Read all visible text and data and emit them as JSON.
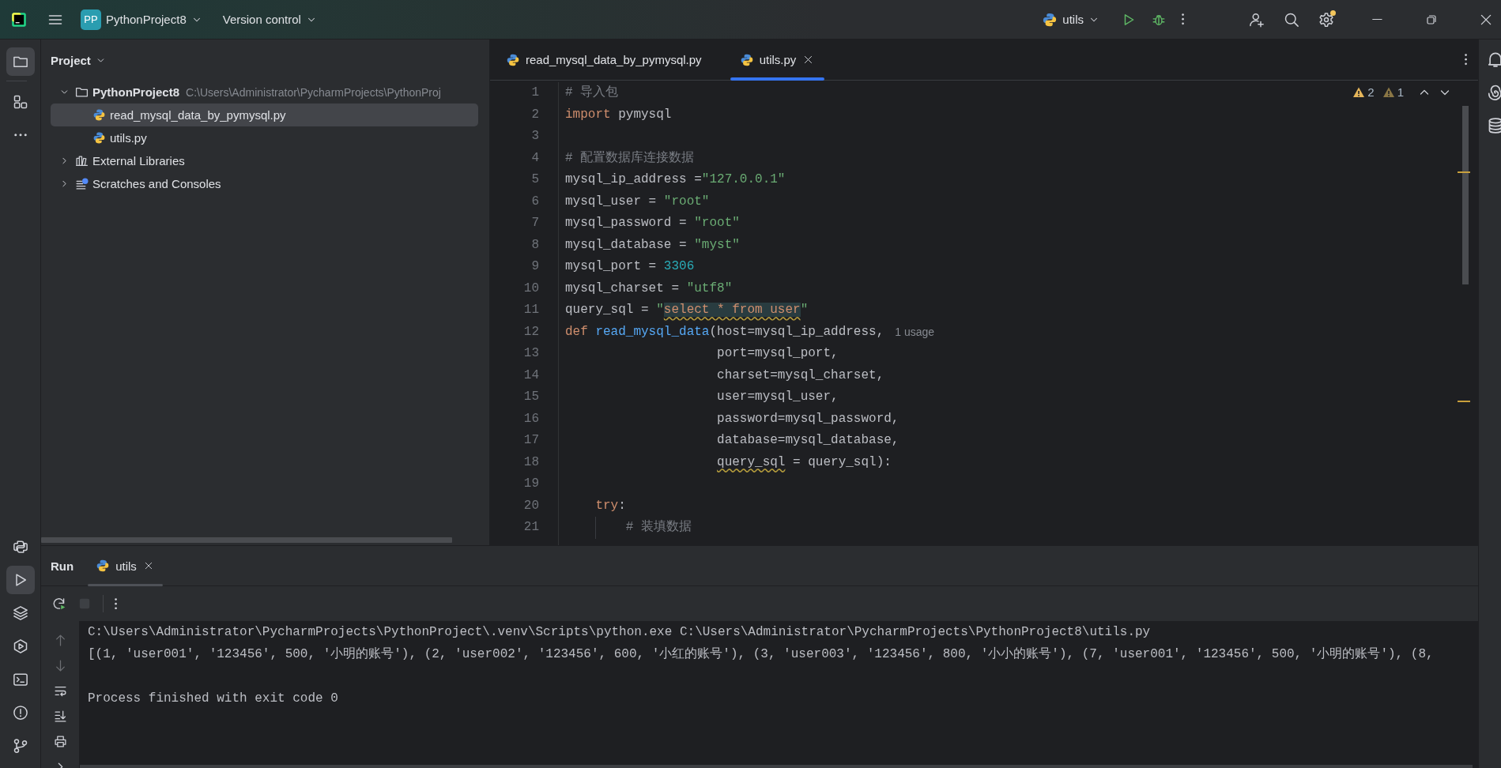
{
  "title_bar": {
    "project_badge": "PP",
    "project": "PythonProject8",
    "vcs": "Version control",
    "run_config": "utils",
    "settings_notification": true
  },
  "left_toolbar": {
    "top": [
      {
        "kind": "project",
        "selected": true
      },
      {
        "kind": "structure",
        "selected": false
      },
      {
        "kind": "more",
        "selected": false
      }
    ],
    "bottom": [
      {
        "kind": "python-console",
        "selected": false
      },
      {
        "kind": "run",
        "selected": true
      },
      {
        "kind": "layers",
        "selected": false
      },
      {
        "kind": "services",
        "selected": false
      },
      {
        "kind": "terminal",
        "selected": false
      },
      {
        "kind": "problems",
        "selected": false
      },
      {
        "kind": "git",
        "selected": false
      }
    ]
  },
  "project_panel": {
    "title": "Project",
    "tree": [
      {
        "kind": "folder",
        "label": "PythonProject8",
        "path": "C:\\Users\\Administrator\\PycharmProjects\\PythonProj",
        "expanded": true,
        "selected": false,
        "children": [
          {
            "kind": "python",
            "label": "read_mysql_data_by_pymysql.py",
            "selected": true
          },
          {
            "kind": "python",
            "label": "utils.py",
            "selected": false
          }
        ]
      },
      {
        "kind": "library",
        "label": "External Libraries",
        "expanded": false,
        "selected": false
      },
      {
        "kind": "scratches",
        "label": "Scratches and Consoles",
        "expanded": false,
        "selected": false
      }
    ]
  },
  "editor": {
    "tabs": [
      {
        "label": "read_mysql_data_by_pymysql.py",
        "selected": false
      },
      {
        "label": "utils.py",
        "selected": true
      }
    ],
    "inspections": [
      {
        "kind": "warning",
        "count": "2"
      },
      {
        "kind": "weak-warning",
        "count": "1"
      }
    ],
    "lines": [
      {
        "number": "1",
        "kind": "top",
        "tokens": [
          {
            "kind": "comment",
            "text": "# 导入包"
          }
        ]
      },
      {
        "number": "2",
        "kind": "top",
        "tokens": [
          {
            "kind": "keyword",
            "text": "import"
          },
          {
            "kind": "plain",
            "text": " pymysql"
          }
        ]
      },
      {
        "number": "3",
        "kind": "top"
      },
      {
        "number": "4",
        "kind": "top",
        "tokens": [
          {
            "kind": "comment",
            "text": "# 配置数据库连接数据"
          }
        ]
      },
      {
        "number": "5",
        "kind": "top",
        "tokens": [
          {
            "kind": "plain",
            "text": "mysql_ip_address ="
          },
          {
            "kind": "string",
            "text": "\"127.0.0.1\""
          }
        ]
      },
      {
        "number": "6",
        "kind": "top",
        "tokens": [
          {
            "kind": "plain",
            "text": "mysql_user = "
          },
          {
            "kind": "string",
            "text": "\"root\""
          }
        ]
      },
      {
        "number": "7",
        "kind": "top",
        "tokens": [
          {
            "kind": "plain",
            "text": "mysql_password = "
          },
          {
            "kind": "string",
            "text": "\"root\""
          }
        ]
      },
      {
        "number": "8",
        "kind": "top",
        "tokens": [
          {
            "kind": "plain",
            "text": "mysql_database = "
          },
          {
            "kind": "string",
            "text": "\"myst\""
          }
        ]
      },
      {
        "number": "9",
        "kind": "top",
        "tokens": [
          {
            "kind": "plain",
            "text": "mysql_port = "
          },
          {
            "kind": "number",
            "text": "3306"
          }
        ]
      },
      {
        "number": "10",
        "kind": "top",
        "tokens": [
          {
            "kind": "plain",
            "text": "mysql_charset = "
          },
          {
            "kind": "string",
            "text": "\"utf8\""
          }
        ]
      },
      {
        "number": "11",
        "kind": "top",
        "tokens": [
          {
            "kind": "plain",
            "text": "query_sql = "
          },
          {
            "kind": "string",
            "text": "\""
          },
          {
            "kind": "sql",
            "text": "select * from user"
          },
          {
            "kind": "string",
            "text": "\""
          }
        ]
      },
      {
        "number": "12",
        "kind": "top",
        "hint": "1 usage",
        "tokens": [
          {
            "kind": "keyword",
            "text": "def "
          },
          {
            "kind": "function",
            "text": "read_mysql_data"
          },
          {
            "kind": "plain",
            "text": "(host=mysql_ip_address,"
          }
        ]
      },
      {
        "number": "13",
        "kind": "continuation",
        "tokens": [
          {
            "kind": "plain",
            "text": "port=mysql_port,"
          }
        ]
      },
      {
        "number": "14",
        "kind": "continuation",
        "tokens": [
          {
            "kind": "plain",
            "text": "charset=mysql_charset,"
          }
        ]
      },
      {
        "number": "15",
        "kind": "continuation",
        "tokens": [
          {
            "kind": "plain",
            "text": "user=mysql_user,"
          }
        ]
      },
      {
        "number": "16",
        "kind": "continuation",
        "tokens": [
          {
            "kind": "plain",
            "text": "password=mysql_password,"
          }
        ]
      },
      {
        "number": "17",
        "kind": "continuation",
        "tokens": [
          {
            "kind": "plain",
            "text": "database=mysql_database,"
          }
        ]
      },
      {
        "number": "18",
        "kind": "continuation",
        "tokens": [
          {
            "kind": "warned",
            "text": "query_sql"
          },
          {
            "kind": "plain",
            "text": " = query_sql):"
          }
        ]
      },
      {
        "number": "19",
        "kind": "top"
      },
      {
        "number": "20",
        "kind": "body1",
        "tokens": [
          {
            "kind": "keyword",
            "text": "try"
          },
          {
            "kind": "plain",
            "text": ":"
          }
        ]
      },
      {
        "number": "21",
        "kind": "body2",
        "tokens": [
          {
            "kind": "comment",
            "text": "# 装填数据"
          }
        ]
      }
    ]
  },
  "run_panel": {
    "title": "Run",
    "tabs": [
      {
        "label": "utils",
        "selected": true
      }
    ],
    "toolbar": [
      {
        "kind": "rerun",
        "disabled": false
      },
      {
        "kind": "stop",
        "disabled": true
      },
      {
        "kind": "more",
        "disabled": false
      }
    ],
    "gutter": [
      {
        "kind": "up",
        "disabled": true
      },
      {
        "kind": "down",
        "disabled": true
      },
      {
        "kind": "wrap",
        "disabled": false
      },
      {
        "kind": "scroll-end",
        "disabled": false
      },
      {
        "kind": "print",
        "disabled": false
      },
      {
        "kind": "expand",
        "disabled": false
      }
    ],
    "console": [
      {
        "kind": "command",
        "text": "C:\\Users\\Administrator\\PycharmProjects\\PythonProject\\.venv\\Scripts\\python.exe C:\\Users\\Administrator\\PycharmProjects\\PythonProject8\\utils.py"
      },
      {
        "kind": "output",
        "text": "[(1, 'user001', '123456', 500, '小明的账号'), (2, 'user002', '123456', 600, '小红的账号'), (3, 'user003', '123456', 800, '小小的账号'), (7, 'user001', '123456', 500, '小明的账号'), (8,"
      },
      {
        "kind": "status",
        "text": "Process finished with exit code 0"
      }
    ]
  },
  "right_toolbar": [
    {
      "kind": "notifications"
    },
    {
      "kind": "ai"
    },
    {
      "kind": "database"
    }
  ]
}
